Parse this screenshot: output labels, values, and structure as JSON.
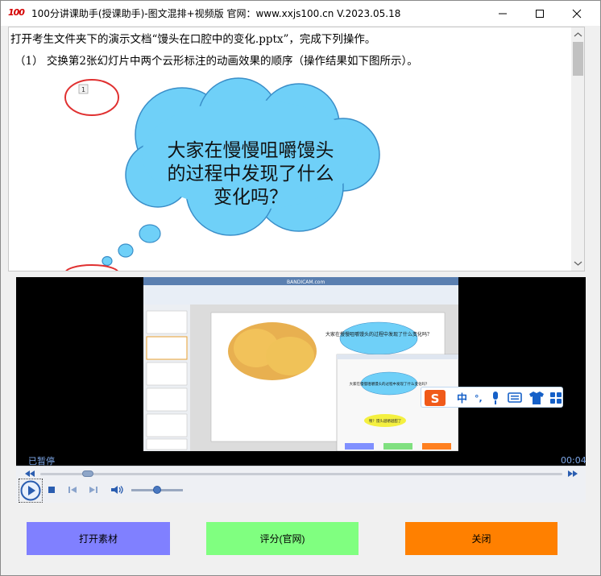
{
  "window": {
    "app_icon_text": "100",
    "title": "100分讲课助手(授课助手)-图文混排+视频版  官网：www.xxjs100.cn V.2023.05.18"
  },
  "document": {
    "line1": "打开考生文件夹下的演示文档“馒头在口腔中的变化.pptx”，完成下列操作。",
    "line2": "（1）  交换第2张幻灯片中两个云形标注的动画效果的顺序（操作结果如下图所示）。",
    "illustration": {
      "badge": "1",
      "cloud_line1": "大家在慢慢咀嚼馒头",
      "cloud_line2": "的过程中发现了什么",
      "cloud_line3": "变化吗？"
    }
  },
  "player": {
    "status": "已暂停",
    "time": "00:04",
    "seek_fraction": 0.08,
    "volume_fraction": 0.5,
    "video": {
      "recorder_watermark": "BANDICAM.com",
      "cloud_text_1": "大家在慢慢咀嚼馒头的过程中发现了什么变化吗？",
      "cloud_text_2": "大家在慢慢咀嚼馒头的过程中发现了什么变化吗？",
      "cloud_text_3": "咦？馒头越嚼越甜了",
      "ime": {
        "logo": "S",
        "mode": "中",
        "punct": "°,"
      }
    }
  },
  "buttons": {
    "open": "打开素材",
    "score": "评分(官网)",
    "close": "关闭"
  },
  "colors": {
    "open_btn": "#8080ff",
    "score_btn": "#80ff80",
    "close_btn": "#ff8000",
    "cloud_fill": "#6fd0f8",
    "status_text": "#7da7e8"
  }
}
